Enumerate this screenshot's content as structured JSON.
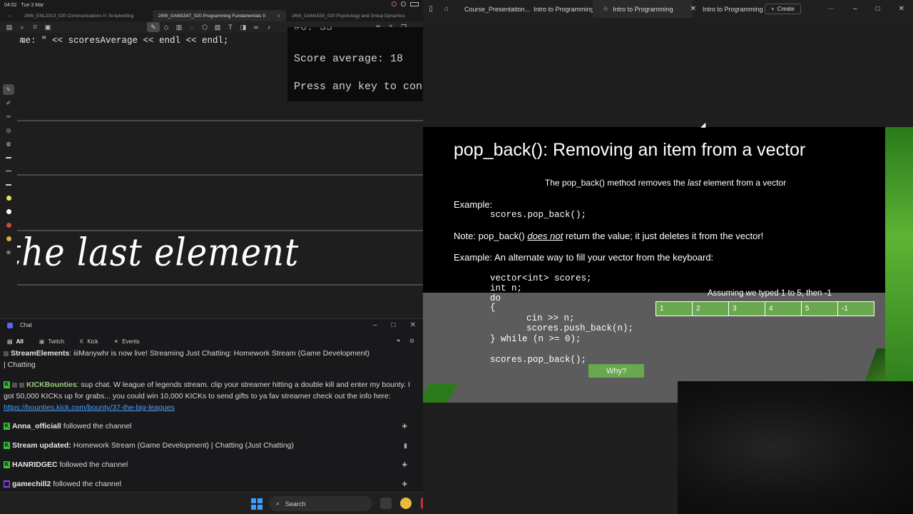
{
  "notes": {
    "status": {
      "time": "04:02",
      "date": "Tue 3 Mar"
    },
    "tabs": [
      "26W_ENL2013_020 Communications II: Scriptwriting",
      "26W_GAM1547_020 Programming Fundamentals II",
      "26W_GAM1530_020 Psychology and Group Dynamics"
    ],
    "code_line": "me: \" << scoresAverage << endl << endl;",
    "console": {
      "line0": "#6: 33",
      "line1": "Score average: 18",
      "line2": "Press any key to con"
    },
    "handwriting": "the last element"
  },
  "chat": {
    "title": "Chat",
    "tabs": {
      "all": "All",
      "twitch": "Twitch",
      "kick": "Kick",
      "events": "Events"
    },
    "messages": {
      "m0_name": "StreamElements",
      "m0_text": ": iiiManywhr is now live! Streaming Just Chatting: Homework Stream (Game Development)",
      "m0_cont": "| Chatting",
      "m1_name": "KICKBounties",
      "m1_text": ": sup chat. W league of legends stream. clip your streamer hitting a double kill and enter my bounty. I got 50,000 KICKs up for grabs... you could win 10,000 KICKs to send gifts to ya fav streamer check out the info here: ",
      "m1_link": "https://bounties.kick.com/bounty/37-the-big-leagues",
      "m2_name": "Anna_officiall",
      "m2_text": " followed the channel",
      "m3_name": "Stream updated:",
      "m3_text": " Homework Stream (Game Development) | Chatting (Just Chatting)",
      "m4_name": "HANRIDGEC",
      "m4_text": " followed the channel",
      "m5_name": "gamechill2",
      "m5_text": " followed the channel"
    }
  },
  "taskbar": {
    "search_label": "Search"
  },
  "browser": {
    "tabs": [
      "Course_Presentation...",
      "Intro to Programming",
      "Intro to Programming",
      "Intro to Programming"
    ],
    "create_label": "Create"
  },
  "slide": {
    "title": "pop_back(): Removing an item from a vector",
    "sub_pre": "The pop_back() method removes the ",
    "sub_em": "last",
    "sub_post": " element from a vector",
    "example1": "Example:",
    "code1": "scores.pop_back();",
    "note_pre": "Note: pop_back() ",
    "note_em": "does not",
    "note_post": " return the value; it just deletes it from the vector!",
    "example2": "Example: An alternate way to fill your vector from the keyboard:",
    "code2": "vector<int> scores;\nint n;\ndo\n{",
    "code3": "cin >> n;\nscores.push_back(n);",
    "code4": "} while (n >= 0);",
    "code5": "scores.pop_back();",
    "why_label": "Why?",
    "assume_label": "Assuming we typed 1 to 5, then -1",
    "vector_cells": [
      "1",
      "2",
      "3",
      "4",
      "5",
      "-1"
    ]
  },
  "colors": {
    "accent_green": "#6aa84f",
    "kick_green": "#3ac13a",
    "link_blue": "#4aa3ff"
  }
}
